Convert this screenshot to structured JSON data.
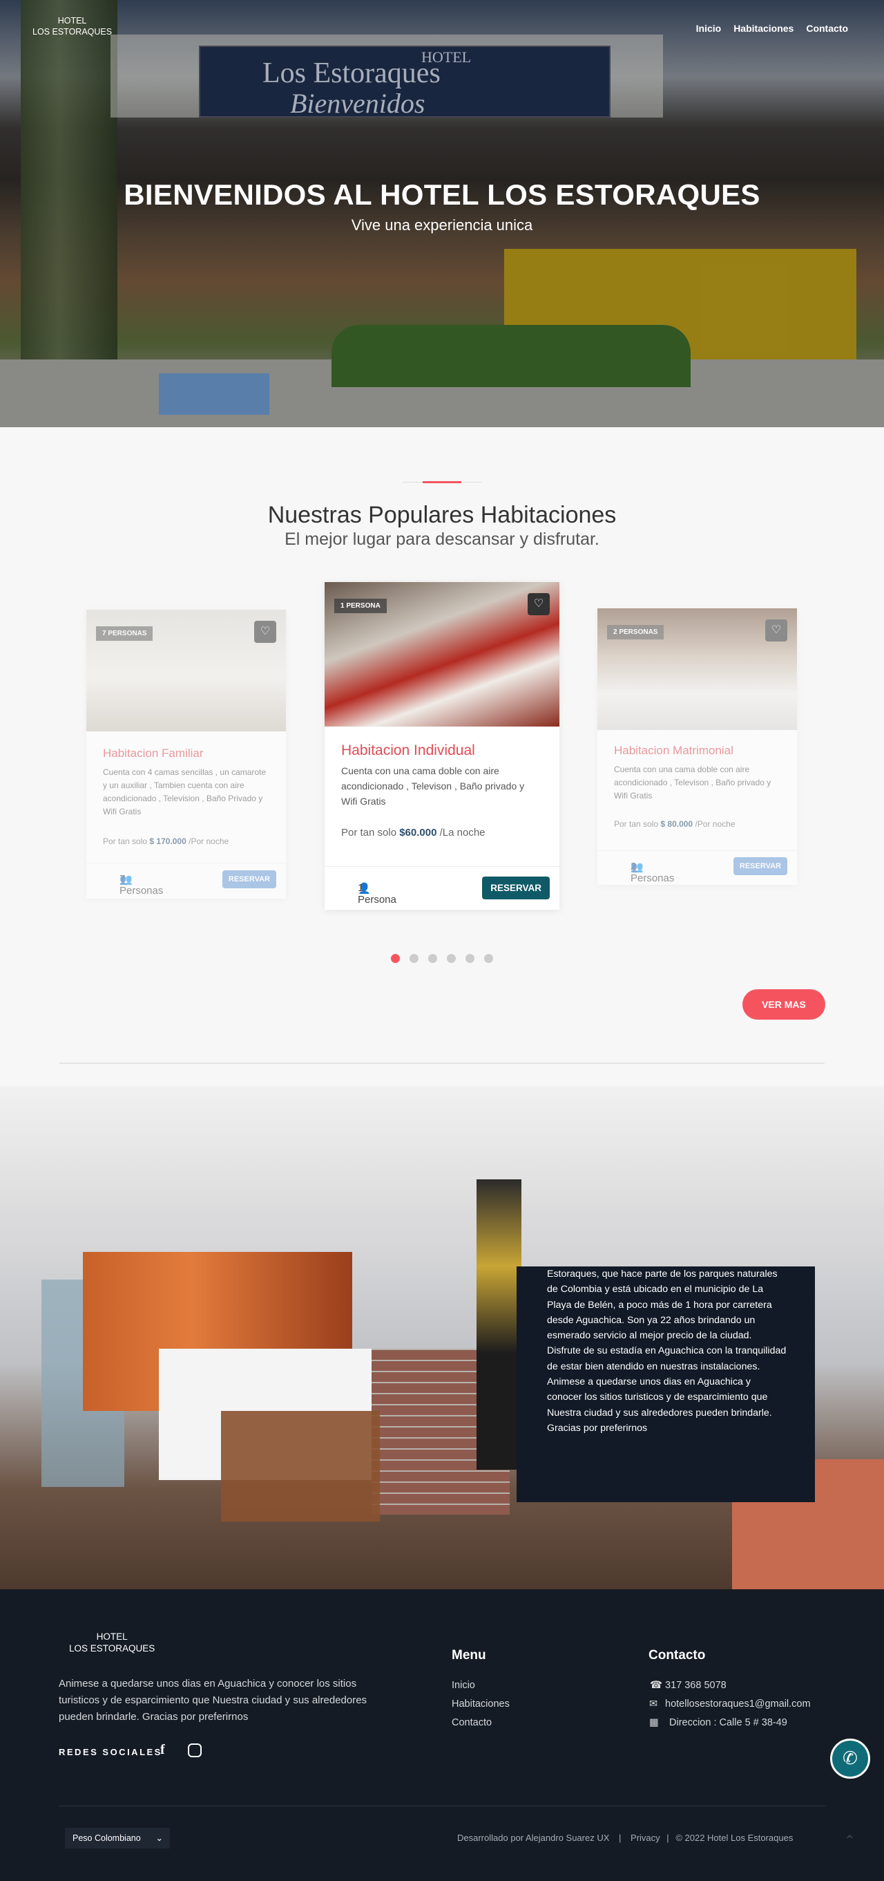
{
  "nav": {
    "brand_line1": "HOTEL",
    "brand_line2": "LOS ESTORAQUES",
    "links": [
      "Inicio",
      "Habitaciones",
      "Contacto"
    ]
  },
  "hero": {
    "title": "BIENVENIDOS AL HOTEL LOS ESTORAQUES",
    "subtitle": "Vive una experiencia unica"
  },
  "rooms": {
    "title": "Nuestras Populares Habitaciones",
    "tagline": "El mejor lugar para descansar y disfrutar.",
    "cards": [
      {
        "badge": "7 PERSONAS",
        "name": "Habitacion Familiar",
        "desc": "Cuenta con 4 camas sencillas , un camarote y un auxiliar , Tambien cuenta con aire acondicionado , Television , Baño Privado y Wifi Gratis",
        "price_prefix": "Por tan solo",
        "price": "$ 170.000",
        "price_suffix": "/Por noche",
        "capacity": "7 Personas",
        "button": "RESERVAR"
      },
      {
        "badge": "1 PERSONA",
        "name": "Habitacion Individual",
        "desc": "Cuenta con una cama doble con aire acondicionado , Televison , Baño privado y Wifi Gratis",
        "price_prefix": "Por tan solo",
        "price": "$60.000",
        "price_suffix": "/La noche",
        "capacity": "1 Persona",
        "button": "RESERVAR"
      },
      {
        "badge": "2 PERSONAS",
        "name": "Habitacion Matrimonial",
        "desc": "Cuenta con una cama doble con aire acondicionado , Televison , Baño privado y Wifi Gratis",
        "price_prefix": "Por tan solo",
        "price": "$ 80.000",
        "price_suffix": "/Por noche",
        "capacity": "2 Personas",
        "button": "RESERVAR"
      }
    ],
    "more_button": "VER MAS"
  },
  "about": {
    "text": "Estoraques, que hace parte de los parques naturales de Colombia y está ubicado en el municipio de La Playa de Belén, a poco más de 1 hora por carretera desde Aguachica. Son ya 22 años brindando un esmerado servicio al mejor precio de la ciudad. Disfrute de su estadía en Aguachica con la tranquilidad de estar bien atendido en nuestras instalaciones. Animese a quedarse unos dias en Aguachica y conocer los sitios turisticos y de esparcimiento que Nuestra ciudad y sus alrededores pueden brindarle. Gracias por preferirnos"
  },
  "footer": {
    "brand_line1": "HOTEL",
    "brand_line2": "LOS ESTORAQUES",
    "description": "Animese a quedarse unos dias en Aguachica y conocer los sitios turisticos y de esparcimiento que Nuestra ciudad y sus alrededores pueden brindarle. Gracias por preferirnos",
    "social_label": "REDES SOCIALES",
    "menu_title": "Menu",
    "menu_links": [
      "Inicio",
      "Habitaciones",
      "Contacto"
    ],
    "contact_title": "Contacto",
    "phone": "317 368 5078",
    "email": "hotellosestoraques1@gmail.com",
    "address": "Direccion : Calle 5 # 38-49",
    "currency": "Peso Colombiano",
    "credit": "Desarrollado por Alejandro Suarez UX",
    "privacy": "Privacy",
    "copyright": "© 2022 Hotel Los Estoraques"
  },
  "hero_sign": {
    "line1": "HOTEL",
    "line2": "Los Estoraques",
    "line3": "Bienvenidos"
  },
  "colors": {
    "accent": "#f5545f",
    "button": "#0f5a66",
    "footer_bg": "#141b24"
  },
  "icons": [
    "heart-icon",
    "user-icon",
    "users-icon",
    "facebook-icon",
    "instagram-icon",
    "phone-icon",
    "mail-icon",
    "map-icon",
    "whatsapp-icon",
    "chevron-down-icon",
    "arrow-up-icon"
  ]
}
